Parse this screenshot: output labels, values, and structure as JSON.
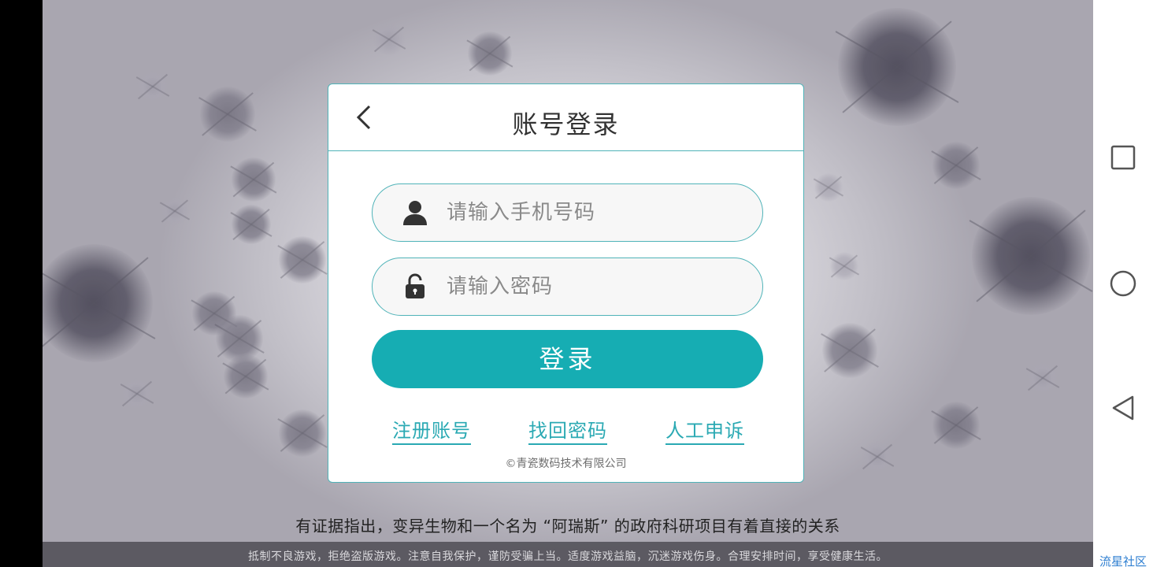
{
  "dialog": {
    "title": "账号登录",
    "back_icon": "chevron-left-icon",
    "phone_field": {
      "icon": "user-icon",
      "placeholder": "请输入手机号码",
      "value": ""
    },
    "password_field": {
      "icon": "lock-icon",
      "placeholder": "请输入密码",
      "value": ""
    },
    "login_button_label": "登录",
    "links": {
      "register": "注册账号",
      "recover_password": "找回密码",
      "manual_appeal": "人工申诉"
    },
    "copyright": "©青瓷数码技术有限公司"
  },
  "game": {
    "story_text": "有证据指出，变异生物和一个名为 “阿瑞斯” 的政府科研项目有着直接的关系",
    "health_notice": "抵制不良游戏，拒绝盗版游戏。注意自我保护，谨防受骗上当。适度游戏益脑，沉迷游戏伤身。合理安排时间，享受健康生活。"
  },
  "system_nav": {
    "recent_icon": "square-icon",
    "home_icon": "circle-icon",
    "back_icon": "triangle-back-icon"
  },
  "watermark": "流星社区",
  "colors": {
    "accent": "#16adb3",
    "border": "#4fb3b8",
    "link": "#2aa9b3",
    "title": "#333333",
    "watermark": "#2f7fd1"
  }
}
